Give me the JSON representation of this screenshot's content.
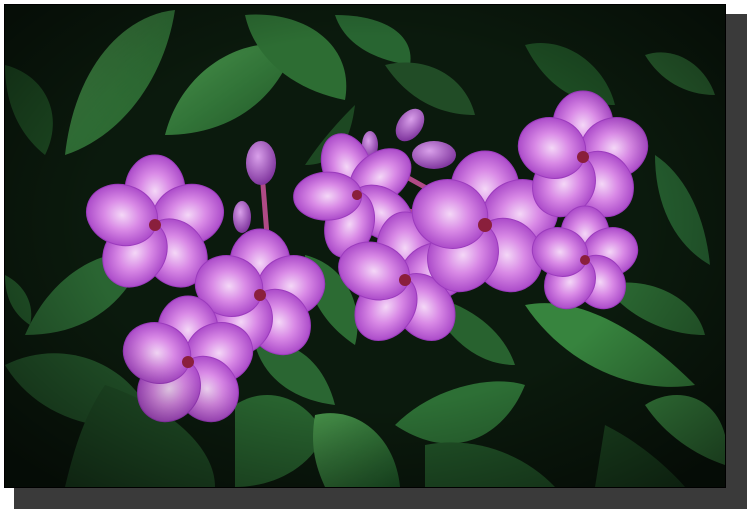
{
  "image": {
    "subject": "phlox-flowers",
    "colors": {
      "background": "#0b1a0d",
      "leaf": "#2e7a3a",
      "leaf_light": "#4c9a4e",
      "petal": "#c04fd8",
      "petal_light": "#e9b8f2",
      "center": "#8a1f3c",
      "frame_shadow": "#3a3a3a"
    }
  }
}
